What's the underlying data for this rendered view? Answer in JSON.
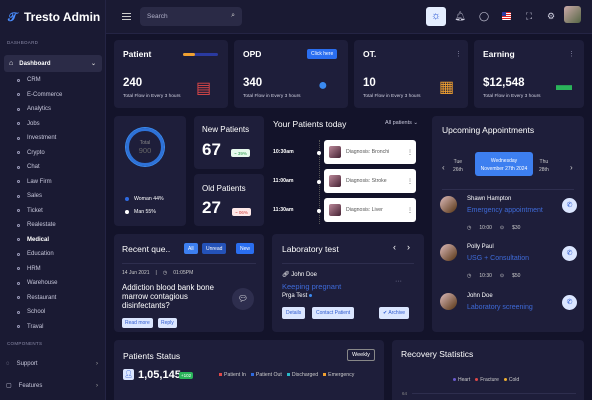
{
  "app": {
    "name": "Tresto Admin"
  },
  "sidebar": {
    "section_main": "DASHBOARD",
    "dashboard": "Dashboard",
    "items": [
      "CRM",
      "E-Commerce",
      "Analytics",
      "Jobs",
      "Investment",
      "Crypto",
      "Chat",
      "Law Firm",
      "Sales",
      "Ticket",
      "Realestate",
      "Medical",
      "Education",
      "HRM",
      "Warehouse",
      "Restaurant",
      "School",
      "Traval"
    ],
    "active_item": "Medical",
    "section_comp": "COMPONENTS",
    "support": "Support",
    "features": "Features"
  },
  "topbar": {
    "search_placeholder": "Search"
  },
  "stats": [
    {
      "title": "Patient",
      "value": "240",
      "sub": "Total Flow in Every 3 hours"
    },
    {
      "title": "OPD",
      "value": "340",
      "sub": "Total Flow in Every 3 hours",
      "button": "Click here"
    },
    {
      "title": "OT.",
      "value": "10",
      "sub": "Total Flow in Every 3 hours"
    },
    {
      "title": "Earning",
      "value": "$12,548",
      "sub": "Total Flow in Every 3 hours"
    }
  ],
  "gender": {
    "total_label": "Total",
    "total_value": "900",
    "woman": "Woman 44%",
    "man": "Man 55%",
    "woman_pct": 44
  },
  "new_patients": {
    "title": "New Patients",
    "value": "67",
    "badge": "~ 39%"
  },
  "old_patients": {
    "title": "Old Patients",
    "value": "27",
    "badge": "~ 06%"
  },
  "today": {
    "title": "Your Patients today",
    "filter": "All patients",
    "rows": [
      {
        "time": "10:30am",
        "dx": "Diagnosis: Bronchi"
      },
      {
        "time": "11:00am",
        "dx": "Diagnosis: Stroke"
      },
      {
        "time": "11:30am",
        "dx": "Diagnosis: Liver"
      }
    ]
  },
  "appointments": {
    "title": "Upcoming Appointments",
    "dates": [
      {
        "d": "Tue",
        "n": "26th"
      },
      {
        "d": "Wednesday",
        "n": "November 27th 2024"
      },
      {
        "d": "Thu",
        "n": "28th"
      }
    ],
    "people": [
      {
        "name": "Shawn Hampton",
        "sub": "Emergency appointment",
        "meta1": "10:00",
        "meta2": "$30"
      },
      {
        "name": "Polly Paul",
        "sub": "USG + Consultation",
        "meta1": "10:30",
        "meta2": "$50"
      },
      {
        "name": "John Doe",
        "sub": "Laboratory screening",
        "meta1": "",
        "meta2": ""
      }
    ]
  },
  "recent": {
    "title": "Recent que..",
    "tabs": [
      "All",
      "Unread",
      "New"
    ],
    "date": "14 Jun 2021",
    "time": "01:05PM",
    "text": "Addiction blood bank bone marrow contagious disinfectants?",
    "tags": [
      "Read more",
      "Reply"
    ]
  },
  "lab": {
    "title": "Laboratory test",
    "patient": "John Doe",
    "status": "Keeping pregnant",
    "test": "Prga Test",
    "buttons": [
      "Details",
      "Contact Patient",
      "Archive"
    ]
  },
  "patients_status": {
    "title": "Patients Status",
    "range": "Weekly",
    "value": "1,05,145",
    "delta": "+102",
    "legend": [
      {
        "label": "Patient In",
        "color": "#e04848"
      },
      {
        "label": "Patient Out",
        "color": "#2e6ae0"
      },
      {
        "label": "Discharged",
        "color": "#29b8c8"
      },
      {
        "label": "Emergency",
        "color": "#f0a030"
      }
    ]
  },
  "recovery": {
    "title": "Recovery Statistics",
    "legend": [
      {
        "label": "Heart",
        "color": "#6a5acd"
      },
      {
        "label": "Fracture",
        "color": "#e04848"
      },
      {
        "label": "Cold",
        "color": "#f0b030"
      }
    ],
    "ytick": "64"
  }
}
